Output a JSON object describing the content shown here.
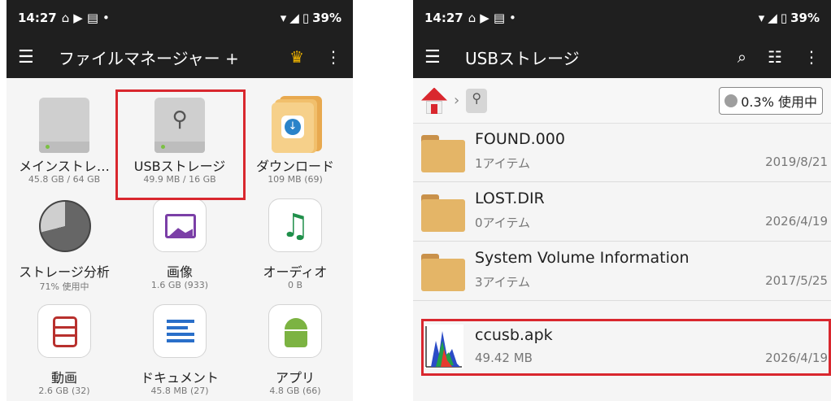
{
  "left": {
    "status": {
      "time": "14:27",
      "battery": "39%"
    },
    "appbar": {
      "title": "ファイルマネージャー +"
    },
    "items": [
      {
        "label": "メインストレ…",
        "sub": "45.8 GB / 64 GB"
      },
      {
        "label": "USBストレージ",
        "sub": "49.9 MB / 16 GB"
      },
      {
        "label": "ダウンロード",
        "sub": "109 MB (69)"
      },
      {
        "label": "ストレージ分析",
        "sub": "71% 使用中"
      },
      {
        "label": "画像",
        "sub": "1.6 GB (933)"
      },
      {
        "label": "オーディオ",
        "sub": "0 B"
      },
      {
        "label": "動画",
        "sub": "2.6 GB (32)"
      },
      {
        "label": "ドキュメント",
        "sub": "45.8 MB (27)"
      },
      {
        "label": "アプリ",
        "sub": "4.8 GB (66)"
      }
    ],
    "storage_used_fraction": 0.71
  },
  "right": {
    "status": {
      "time": "14:27",
      "battery": "39%"
    },
    "appbar": {
      "title": "USBストレージ"
    },
    "usage": "0.3% 使用中",
    "files": [
      {
        "name": "FOUND.000",
        "meta": "1アイテム",
        "date": "2019/8/21"
      },
      {
        "name": "LOST.DIR",
        "meta": "0アイテム",
        "date": "2026/4/19"
      },
      {
        "name": "System Volume Information",
        "meta": "3アイテム",
        "date": "2017/5/25"
      },
      {
        "name": "ccusb.apk",
        "meta": "49.42 MB",
        "date": "2026/4/19"
      }
    ]
  },
  "colors": {
    "bar": "#1f1f1f",
    "highlight": "#d9272e",
    "folder": "#e4b567"
  }
}
